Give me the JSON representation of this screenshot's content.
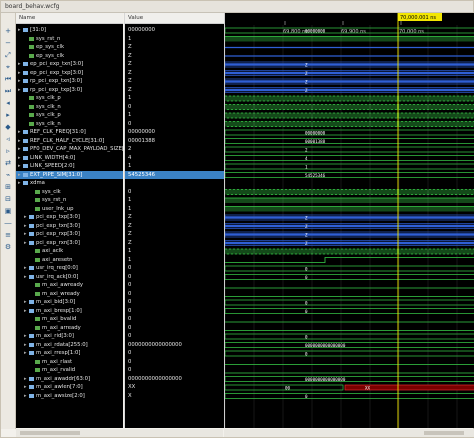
{
  "window": {
    "title": "board_behav.wcfg"
  },
  "columns": {
    "name": "Name",
    "value": "Value"
  },
  "time": {
    "cursor_label": "70,000.001 ns",
    "ruler_labels": [
      "69,800 ns",
      "69,900 ns",
      "70,000 ns"
    ]
  },
  "toolbar_icons": [
    "zoom-in-icon",
    "zoom-out-icon",
    "zoom-fit-icon",
    "zoom-cursor-icon",
    "go-start-icon",
    "go-end-icon",
    "prev-edge-icon",
    "next-edge-icon",
    "add-marker-icon",
    "prev-marker-icon",
    "next-marker-icon",
    "swap-cursor-icon",
    "snap-icon",
    "expand-icon",
    "collapse-icon",
    "group-icon",
    "divider-icon",
    "virtual-bus-icon",
    "settings-icon"
  ],
  "signals": [
    {
      "name": "[31:0]",
      "value": "00000000",
      "kind": "bus",
      "indent": 0,
      "expand": true
    },
    {
      "name": "sys_rst_n",
      "value": "1",
      "kind": "bit",
      "indent": 1
    },
    {
      "name": "ep_sys_clk",
      "value": "Z",
      "kind": "bit",
      "indent": 1
    },
    {
      "name": "ep_sys_clk",
      "value": "Z",
      "kind": "bit",
      "indent": 1
    },
    {
      "name": "ep_pci_exp_txn[3:0]",
      "value": "Z",
      "kind": "bus",
      "indent": 0,
      "expand": true
    },
    {
      "name": "ep_pci_exp_txp[3:0]",
      "value": "Z",
      "kind": "bus",
      "indent": 0,
      "expand": true
    },
    {
      "name": "rp_pci_exp_txn[3:0]",
      "value": "Z",
      "kind": "bus",
      "indent": 0,
      "expand": true
    },
    {
      "name": "rp_pci_exp_txp[3:0]",
      "value": "Z",
      "kind": "bus",
      "indent": 0,
      "expand": true
    },
    {
      "name": "sys_clk_p",
      "value": "1",
      "kind": "bit",
      "indent": 1
    },
    {
      "name": "sys_clk_n",
      "value": "0",
      "kind": "bit",
      "indent": 1
    },
    {
      "name": "sys_clk_p",
      "value": "1",
      "kind": "bit",
      "indent": 1
    },
    {
      "name": "sys_clk_n",
      "value": "0",
      "kind": "bit",
      "indent": 1
    },
    {
      "name": "REF_CLK_FREQ[31:0]",
      "value": "00000000",
      "kind": "bus",
      "indent": 0,
      "expand": true
    },
    {
      "name": "REF_CLK_HALF_CYCLE[31:0]",
      "value": "00001388",
      "kind": "bus",
      "indent": 0,
      "expand": true
    },
    {
      "name": "PF0_DEV_CAP_MAX_PAYLOAD_SIZE[2:0]",
      "value": "2",
      "kind": "bus",
      "indent": 0,
      "expand": true
    },
    {
      "name": "LINK_WIDTH[4:0]",
      "value": "4",
      "kind": "bus",
      "indent": 0,
      "expand": true
    },
    {
      "name": "LINK_SPEED[2:0]",
      "value": "1",
      "kind": "bus",
      "indent": 0,
      "expand": true
    },
    {
      "name": "EXT_PIPE_SIM[31:0]",
      "value": "54525346",
      "kind": "bus",
      "indent": 0,
      "expand": true,
      "selected": true
    },
    {
      "name": "xdma",
      "value": "",
      "kind": "group",
      "indent": 0,
      "expand": true
    },
    {
      "name": "sys_clk",
      "value": "0",
      "kind": "bit",
      "indent": 2
    },
    {
      "name": "sys_rst_n",
      "value": "1",
      "kind": "bit",
      "indent": 2
    },
    {
      "name": "user_lnk_up",
      "value": "1",
      "kind": "bit",
      "indent": 2
    },
    {
      "name": "pci_exp_txp[3:0]",
      "value": "Z",
      "kind": "bus",
      "indent": 1,
      "expand": true
    },
    {
      "name": "pci_exp_txn[3:0]",
      "value": "Z",
      "kind": "bus",
      "indent": 1,
      "expand": true
    },
    {
      "name": "pci_exp_rxp[3:0]",
      "value": "Z",
      "kind": "bus",
      "indent": 1,
      "expand": true
    },
    {
      "name": "pci_exp_rxn[3:0]",
      "value": "Z",
      "kind": "bus",
      "indent": 1,
      "expand": true
    },
    {
      "name": "axi_aclk",
      "value": "1",
      "kind": "bit",
      "indent": 2
    },
    {
      "name": "axi_aresetn",
      "value": "1",
      "kind": "bit",
      "indent": 2
    },
    {
      "name": "usr_irq_req[0:0]",
      "value": "0",
      "kind": "bus",
      "indent": 1,
      "expand": true
    },
    {
      "name": "usr_irq_ack[0:0]",
      "value": "0",
      "kind": "bus",
      "indent": 1,
      "expand": true
    },
    {
      "name": "m_axi_awready",
      "value": "0",
      "kind": "bit",
      "indent": 2
    },
    {
      "name": "m_axi_wready",
      "value": "0",
      "kind": "bit",
      "indent": 2
    },
    {
      "name": "m_axi_bid[3:0]",
      "value": "0",
      "kind": "bus",
      "indent": 1,
      "expand": true
    },
    {
      "name": "m_axi_bresp[1:0]",
      "value": "0",
      "kind": "bus",
      "indent": 1,
      "expand": true
    },
    {
      "name": "m_axi_bvalid",
      "value": "0",
      "kind": "bit",
      "indent": 2
    },
    {
      "name": "m_axi_arready",
      "value": "0",
      "kind": "bit",
      "indent": 2
    },
    {
      "name": "m_axi_rid[3:0]",
      "value": "0",
      "kind": "bus",
      "indent": 1,
      "expand": true
    },
    {
      "name": "m_axi_rdata[255:0]",
      "value": "0000000000000000",
      "kind": "bus",
      "indent": 1,
      "expand": true
    },
    {
      "name": "m_axi_rresp[1:0]",
      "value": "0",
      "kind": "bus",
      "indent": 1,
      "expand": true
    },
    {
      "name": "m_axi_rlast",
      "value": "0",
      "kind": "bit",
      "indent": 2
    },
    {
      "name": "m_axi_rvalid",
      "value": "0",
      "kind": "bit",
      "indent": 2
    },
    {
      "name": "m_axi_awaddr[63:0]",
      "value": "0000000000000000",
      "kind": "bus",
      "indent": 1,
      "expand": true
    },
    {
      "name": "m_axi_awlen[7:0]",
      "value": "XX",
      "kind": "bus",
      "indent": 1,
      "expand": true
    },
    {
      "name": "m_axi_awsize[2:0]",
      "value": "X",
      "kind": "bus",
      "indent": 1,
      "expand": true
    }
  ],
  "waves": [
    {
      "type": "bus",
      "color": "#39d24a",
      "text": "00000000"
    },
    {
      "type": "high",
      "color": "#39d24a"
    },
    {
      "type": "z",
      "color": "#2f5fd6"
    },
    {
      "type": "z",
      "color": "#2f5fd6"
    },
    {
      "type": "zbus",
      "color": "#2f5fd6",
      "text": "Z"
    },
    {
      "type": "zbus",
      "color": "#2f5fd6",
      "text": "Z"
    },
    {
      "type": "zbus",
      "color": "#2f5fd6",
      "text": "Z"
    },
    {
      "type": "zbus",
      "color": "#2f5fd6",
      "text": "Z"
    },
    {
      "type": "clock",
      "color": "#39d24a"
    },
    {
      "type": "clock",
      "color": "#39d24a"
    },
    {
      "type": "clock",
      "color": "#39d24a"
    },
    {
      "type": "clock",
      "color": "#39d24a"
    },
    {
      "type": "bus",
      "color": "#39d24a",
      "text": "00000000"
    },
    {
      "type": "bus",
      "color": "#39d24a",
      "text": "00001388"
    },
    {
      "type": "bus",
      "color": "#39d24a",
      "text": "2"
    },
    {
      "type": "bus",
      "color": "#39d24a",
      "text": "4"
    },
    {
      "type": "bus",
      "color": "#39d24a",
      "text": "1"
    },
    {
      "type": "bus",
      "color": "#39d24a",
      "text": "54525346"
    },
    {
      "type": "none"
    },
    {
      "type": "clock",
      "color": "#39d24a"
    },
    {
      "type": "high",
      "color": "#39d24a"
    },
    {
      "type": "high",
      "color": "#39d24a"
    },
    {
      "type": "zbus",
      "color": "#2f5fd6",
      "text": "Z"
    },
    {
      "type": "zbus",
      "color": "#2f5fd6",
      "text": "Z"
    },
    {
      "type": "zbus",
      "color": "#2f5fd6",
      "text": "Z"
    },
    {
      "type": "zbus",
      "color": "#2f5fd6",
      "text": "Z"
    },
    {
      "type": "clock",
      "color": "#39d24a"
    },
    {
      "type": "rise",
      "color": "#39d24a"
    },
    {
      "type": "bus",
      "color": "#39d24a",
      "text": "0"
    },
    {
      "type": "bus",
      "color": "#39d24a",
      "text": "0"
    },
    {
      "type": "low",
      "color": "#39d24a"
    },
    {
      "type": "low",
      "color": "#39d24a"
    },
    {
      "type": "bus",
      "color": "#39d24a",
      "text": "0"
    },
    {
      "type": "bus",
      "color": "#39d24a",
      "text": "0"
    },
    {
      "type": "low",
      "color": "#39d24a"
    },
    {
      "type": "low",
      "color": "#39d24a"
    },
    {
      "type": "bus",
      "color": "#39d24a",
      "text": "0"
    },
    {
      "type": "bus",
      "color": "#39d24a",
      "text": "0000000000000000"
    },
    {
      "type": "bus",
      "color": "#39d24a",
      "text": "0"
    },
    {
      "type": "low",
      "color": "#39d24a"
    },
    {
      "type": "low",
      "color": "#39d24a"
    },
    {
      "type": "bus",
      "color": "#39d24a",
      "text": "0000000000000000"
    },
    {
      "type": "busx",
      "color": "#39d24a",
      "text": "00",
      "xtext": "XX"
    },
    {
      "type": "bus",
      "color": "#39d24a",
      "text": "0"
    }
  ],
  "colors": {
    "cursor": "#f2e600",
    "grid": "#2c2c2c",
    "selected": "#3b82c4"
  }
}
